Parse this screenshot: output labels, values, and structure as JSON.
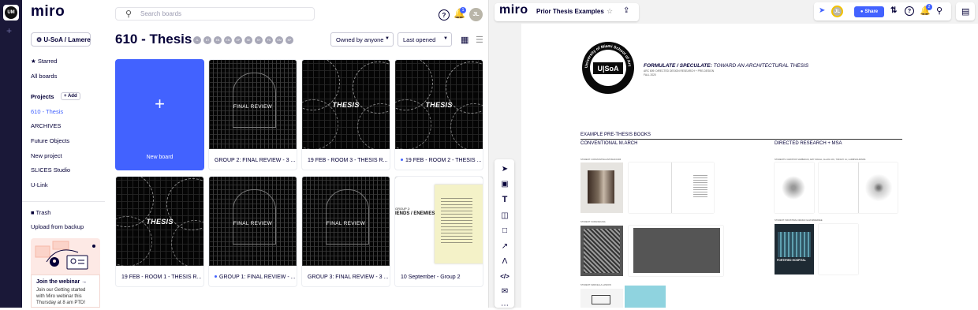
{
  "dashboard": {
    "logo": "miro",
    "workspace_badge": "UM",
    "search_placeholder": "Search boards",
    "help_icon_glyph": "?",
    "notifications_count": "1",
    "user_initials": "JL",
    "team_selector": "U-SoA / Lamere",
    "nav": {
      "starred": "Starred",
      "all_boards": "All boards",
      "projects_heading": "Projects",
      "add_label": "+ Add",
      "projects": [
        "610 - Thesis",
        "ARCHIVES",
        "Future Objects",
        "New project",
        "SLICES Studio",
        "U-Link"
      ],
      "active_project_index": 0,
      "trash": "Trash",
      "upload": "Upload from backup"
    },
    "webinar": {
      "title": "Join the webinar →",
      "text_lines": [
        "Join our Getting started",
        "with Miro webinar this",
        "Thursday at 8 am PTD!"
      ]
    },
    "page_title": "610 - Thesis",
    "members": [
      "JL",
      "BT",
      "EB",
      "EM",
      "EP",
      "SE",
      "SY",
      "FS",
      "GM",
      "KP"
    ],
    "filter_owner": "Owned by anyone",
    "sort": "Last opened",
    "boards": [
      {
        "title": "New board",
        "kind": "new"
      },
      {
        "title": "GROUP 2: FINAL REVIEW - 3 ...",
        "thumb_text": "FINAL REVIEW",
        "kind": "review"
      },
      {
        "title": "19 FEB - ROOM 3 - THESIS R...",
        "thumb_text": "THESIS",
        "kind": "thesis"
      },
      {
        "title": "19 FEB - ROOM 2 - THESIS ...",
        "thumb_text": "THESIS",
        "kind": "thesis",
        "dot": true
      },
      {
        "title": "19 FEB - ROOM 1 - THESIS R...",
        "thumb_text": "THESIS",
        "kind": "thesis"
      },
      {
        "title": "GROUP 1: FINAL REVIEW - ...",
        "thumb_text": "FINAL REVIEW",
        "kind": "review",
        "dot": true
      },
      {
        "title": "GROUP 3: FINAL REVIEW - 3 ...",
        "thumb_text": "FINAL REVIEW",
        "kind": "review"
      },
      {
        "title": "10 September - Group 2",
        "thumb_text": "IENDS  / ENEMIES",
        "thumb_sub": "GROUP 2:",
        "kind": "paper"
      }
    ]
  },
  "board": {
    "logo": "miro",
    "title": "Prior Thesis Examples",
    "share": "Share",
    "notifications_count": "2",
    "canvas": {
      "seal_text": "University of Miami School of Architecture",
      "seal_logo": "U|SoA",
      "heading_bold": "FORMULATE / SPECULATE:",
      "heading_rest": " TOWARD AN ARCHITECTURAL THESIS",
      "subline1": "ARC 609: DIRECTED DESIGN RESEARCH + PRE-DESIGN",
      "subline2": "FALL 2020",
      "section": "EXAMPLE PRE-THESIS BOOKS",
      "col1": "CONVENTIONAL M.ARCH",
      "col2": "DIRECTED RESEARCH + MSA",
      "student_labels": [
        "STUDENT: CONSTANTINA ANTONAKOUDI",
        "STUDENT: SURANGKANA",
        "STUDENT: MARCELLA LANDON",
        "STUDENTS: CHRISTOS VAMBAKAS, AMY KAVALL, ALLAN LOU, TIFFANY LU, LARRISSA MINNS",
        "STUDENT: INDUSTRIAL DESIGN GAIA BANERJEE"
      ],
      "poster_text": "FORTIFIED HOSPITAL"
    }
  }
}
